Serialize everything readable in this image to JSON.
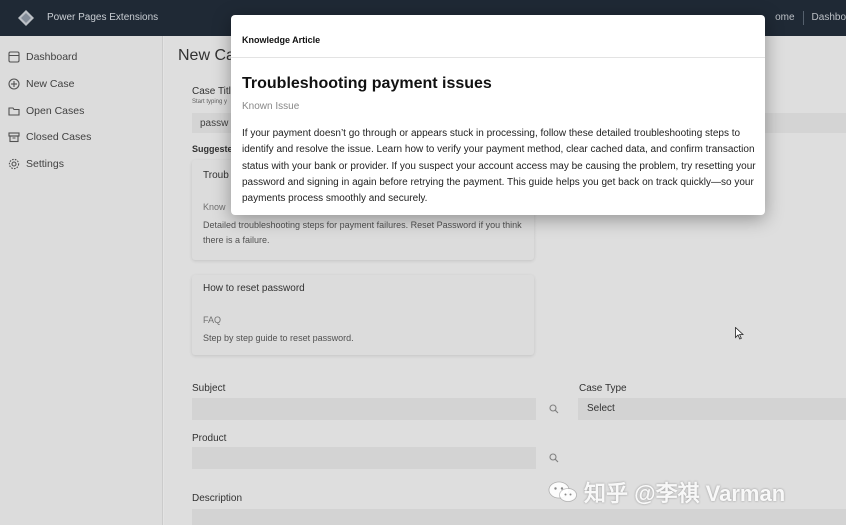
{
  "navbar": {
    "brand": "Power Pages Extensions",
    "links": [
      "ome",
      "Dashbo"
    ]
  },
  "sidebar": {
    "items": [
      {
        "label": "Dashboard",
        "icon": "grid-icon"
      },
      {
        "label": "New Case",
        "icon": "plus-circle-icon"
      },
      {
        "label": "Open Cases",
        "icon": "folder-icon"
      },
      {
        "label": "Closed Cases",
        "icon": "archive-icon"
      },
      {
        "label": "Settings",
        "icon": "gear-icon"
      }
    ]
  },
  "main": {
    "page_title": "New Ca",
    "case_title_label": "Case Titl",
    "case_title_hint": "Start typing y",
    "case_title_value": "passw",
    "suggested_label": "Suggeste",
    "suggestions": [
      {
        "title": "Troub",
        "category": "Know",
        "description": "Detailed troubleshooting steps for payment failures. Reset Password if you think there is a failure."
      },
      {
        "title": "How to reset password",
        "category": "FAQ",
        "description": "Step by step guide to reset password."
      }
    ],
    "subject_label": "Subject",
    "case_type_label": "Case Type",
    "case_type_value": "Select",
    "product_label": "Product",
    "description_label": "Description"
  },
  "modal": {
    "heading": "Knowledge Article",
    "title": "Troubleshooting payment issues",
    "subtitle": "Known Issue",
    "body": "If your payment doesn’t go through or appears stuck in processing, follow these detailed troubleshooting steps to identify and resolve the issue. Learn how to verify your payment method, clear cached data, and confirm transaction status with your bank or provider. If you suspect your account access may be causing the problem, try resetting your password and signing in again before retrying the payment. This guide helps you get back on track quickly—so your payments process smoothly and securely."
  },
  "watermark": {
    "text": "知乎 @李祺 Varman"
  },
  "colors": {
    "navbar": "#1f2a37",
    "modal_bg": "#ffffff",
    "page_bg": "#eeeeee"
  }
}
